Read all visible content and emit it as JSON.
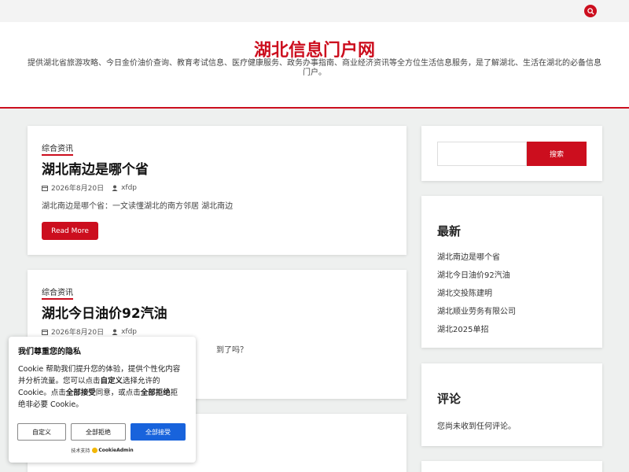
{
  "header": {
    "site_title": "湖北信息门户网",
    "site_description": "提供湖北省旅游攻略、今日金价油价查询、教育考试信息、医疗健康服务、政务办事指南、商业经济资讯等全方位生活信息服务，是了解湖北、生活在湖北的必备信息门户。"
  },
  "posts": [
    {
      "category": "综合资讯",
      "title": "湖北南边是哪个省",
      "date": "2026年8月20日",
      "author": "xfdp",
      "excerpt": "湖北南边是哪个省：一文读懂湖北的南方邻居 湖北南边",
      "read_more": "Read More"
    },
    {
      "category": "综合资讯",
      "title": "湖北今日油价92汽油",
      "date": "2026年8月20日",
      "author": "xfdp",
      "excerpt_tail": "到了吗？"
    }
  ],
  "sidebar": {
    "search_button": "搜索",
    "latest_title": "最新",
    "latest_items": [
      "湖北南边是哪个省",
      "湖北今日油价92汽油",
      "湖北交投陈建明",
      "湖北顺业劳务有限公司",
      "湖北2025单招"
    ],
    "comments_title": "评论",
    "comments_empty": "您尚未收到任何评论。"
  },
  "cookie": {
    "title": "我们尊重您的隐私",
    "text_1": "Cookie 帮助我们提升您的体验，提供个性化内容并分析流量。您可以点击",
    "text_customize": "自定义",
    "text_2": "选择允许的 Cookie。点击",
    "text_accept": "全部接受",
    "text_3": "同意，或点击",
    "text_reject": "全部拒绝",
    "text_4": "拒绝非必要 Cookie。",
    "btn_customize": "自定义",
    "btn_reject": "全部拒绝",
    "btn_accept": "全部接受",
    "powered_by": "技术支持",
    "brand": "CookieAdmin"
  },
  "colors": {
    "accent": "#cc0e1e",
    "cookie_primary": "#1863dc"
  },
  "icons": {
    "search": "search-icon",
    "date": "calendar-icon",
    "author": "user-icon"
  }
}
